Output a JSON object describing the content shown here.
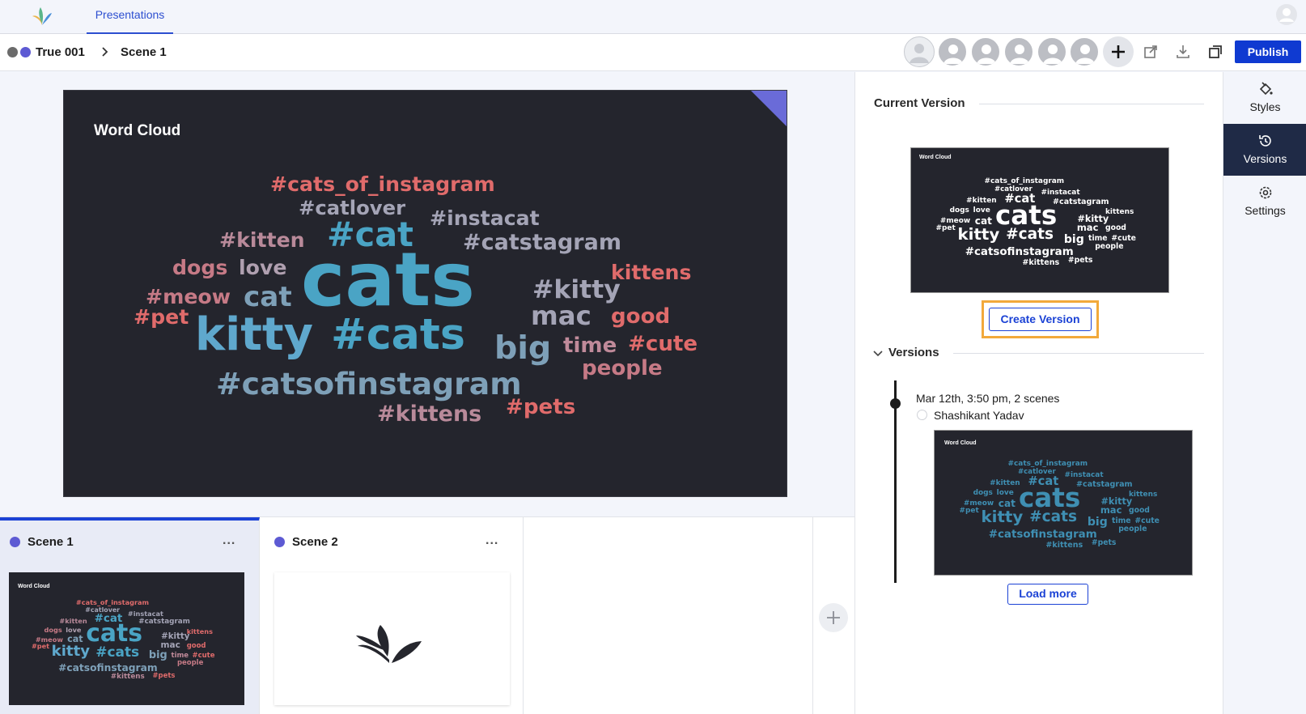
{
  "topbar": {
    "tab": "Presentations"
  },
  "breadcrumb": {
    "project": "True 001",
    "scene": "Scene 1"
  },
  "toolbar": {
    "publish_label": "Publish"
  },
  "slide": {
    "title": "Word Cloud",
    "words": [
      {
        "text": "#cats_of_instagram",
        "color": "#e06b6b"
      },
      {
        "text": "#catlover",
        "color": "#a4a4b6"
      },
      {
        "text": "#instacat",
        "color": "#a4a4b6"
      },
      {
        "text": "#kitten",
        "color": "#b98a9a"
      },
      {
        "text": "#cat",
        "color": "#4aa4c5"
      },
      {
        "text": "#catstagram",
        "color": "#a4a4b6"
      },
      {
        "text": "dogs",
        "color": "#c67a86"
      },
      {
        "text": "love",
        "color": "#b0a0b0"
      },
      {
        "text": "cats",
        "color": "#4aa4c5"
      },
      {
        "text": "kittens",
        "color": "#e06b6b"
      },
      {
        "text": "#meow",
        "color": "#c67a86"
      },
      {
        "text": "cat",
        "color": "#7ea0b8"
      },
      {
        "text": "#kitty",
        "color": "#a4a4b6"
      },
      {
        "text": "#pet",
        "color": "#e06b6b"
      },
      {
        "text": "mac",
        "color": "#a4a4b6"
      },
      {
        "text": "good",
        "color": "#e06b6b"
      },
      {
        "text": "kitty",
        "color": "#5fa8cd"
      },
      {
        "text": "#cats",
        "color": "#4aa4c5"
      },
      {
        "text": "big",
        "color": "#7ea0b8"
      },
      {
        "text": "time",
        "color": "#c08a9a"
      },
      {
        "text": "#cute",
        "color": "#e06b6b"
      },
      {
        "text": "#catsofinstagram",
        "color": "#7ea0b8"
      },
      {
        "text": "people",
        "color": "#c67a86"
      },
      {
        "text": "#kittens",
        "color": "#b98a9a"
      },
      {
        "text": "#pets",
        "color": "#e06b6b"
      }
    ]
  },
  "scenes": [
    {
      "name": "Scene 1",
      "menu": "..."
    },
    {
      "name": "Scene 2",
      "menu": "..."
    }
  ],
  "thumb_title": "Word Cloud",
  "panel": {
    "current_version_heading": "Current Version",
    "create_version_label": "Create Version",
    "versions_heading": "Versions",
    "version": {
      "meta": "Mar 12th, 3:50 pm, 2 scenes",
      "author": "Shashikant Yadav"
    },
    "load_more_label": "Load more"
  },
  "rail": {
    "styles_label": "Styles",
    "versions_label": "Versions",
    "settings_label": "Settings"
  },
  "colors": {
    "accent": "#1b42d5",
    "publish": "#0f3ad1",
    "slide_bg": "#24252d",
    "rail_active": "#1f2a46",
    "highlight_outline": "#f2a93b"
  }
}
